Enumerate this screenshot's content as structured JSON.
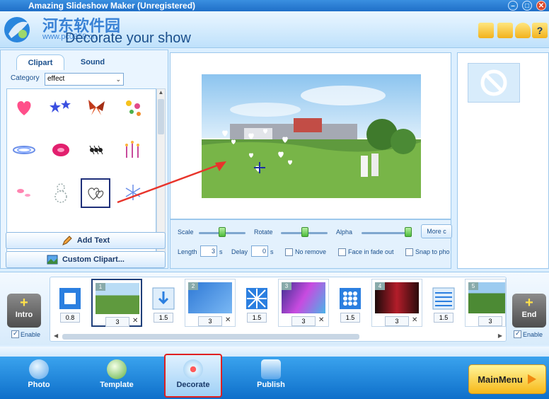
{
  "window": {
    "title": "Amazing Slideshow Maker (Unregistered)"
  },
  "header": {
    "page_title": "Decorate your show",
    "watermark": "河东软件园",
    "watermark_url": "www.pc0359.cn"
  },
  "left_panel": {
    "tabs": [
      "Clipart",
      "Sound"
    ],
    "category_label": "Category",
    "category_value": "effect",
    "add_text_label": "Add Text",
    "custom_clipart_label": "Custom Clipart..."
  },
  "controls": {
    "scale_label": "Scale",
    "rotate_label": "Rotate",
    "alpha_label": "Alpha",
    "more_label": "More c",
    "length_label": "Length",
    "length_value": "3",
    "length_unit": "s",
    "delay_label": "Delay",
    "delay_value": "0",
    "delay_unit": "s",
    "no_remove_label": "No remove",
    "face_fade_label": "Face in fade out",
    "snap_label": "Snap to pho"
  },
  "timeline": {
    "intro_label": "Intro",
    "end_label": "End",
    "enable_label": "Enable",
    "first_transition_duration": "0.8",
    "slides": [
      {
        "number": "1",
        "duration": "3"
      },
      {
        "number": "2",
        "duration": "3"
      },
      {
        "number": "3",
        "duration": "3"
      },
      {
        "number": "4",
        "duration": "3"
      },
      {
        "number": "5",
        "duration": "3"
      }
    ],
    "transitions": [
      "1.5",
      "1.5",
      "1.5",
      "1.5"
    ],
    "delete_symbol": "✕"
  },
  "bottom_nav": {
    "items": [
      "Photo",
      "Template",
      "Decorate",
      "Publish"
    ],
    "active": "Decorate",
    "main_menu_label": "MainMenu"
  },
  "colors": {
    "accent": "#1f6fc8",
    "nav_bar": "#0e6fca",
    "highlight_border": "#e02020",
    "annotation_arrow": "#e8342b",
    "main_menu": "#f7b818"
  }
}
